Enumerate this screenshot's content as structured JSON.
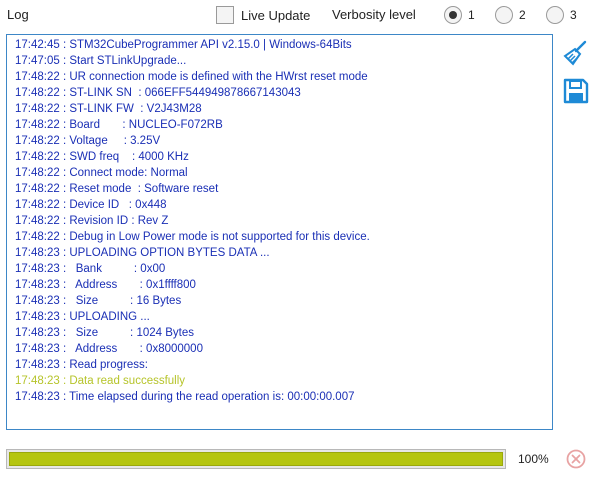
{
  "header": {
    "title": "Log",
    "live_update_label": "Live Update",
    "live_update_checked": false,
    "verbosity_label": "Verbosity level",
    "verbosity_options": [
      "1",
      "2",
      "3"
    ],
    "verbosity_selected": "1"
  },
  "log": {
    "lines": [
      "17:42:45 : STM32CubeProgrammer API v2.15.0 | Windows-64Bits",
      "17:47:05 : Start STLinkUpgrade...",
      "17:48:22 : UR connection mode is defined with the HWrst reset mode",
      "17:48:22 : ST-LINK SN  : 066EFF544949878667143043",
      "17:48:22 : ST-LINK FW  : V2J43M28",
      "17:48:22 : Board       : NUCLEO-F072RB",
      "17:48:22 : Voltage     : 3.25V",
      "17:48:22 : SWD freq    : 4000 KHz",
      "17:48:22 : Connect mode: Normal",
      "17:48:22 : Reset mode  : Software reset",
      "17:48:22 : Device ID   : 0x448",
      "17:48:22 : Revision ID : Rev Z",
      "17:48:22 : Debug in Low Power mode is not supported for this device.",
      "17:48:23 : UPLOADING OPTION BYTES DATA ...",
      "17:48:23 :   Bank          : 0x00",
      "17:48:23 :   Address       : 0x1ffff800",
      "17:48:23 :   Size          : 16 Bytes",
      "17:48:23 : UPLOADING ...",
      "17:48:23 :   Size          : 1024 Bytes",
      "17:48:23 :   Address       : 0x8000000",
      "17:48:23 : Read progress:",
      "17:48:23 : Data read successfully",
      "17:48:23 : Time elapsed during the read operation is: 00:00:00.007"
    ],
    "success_line_index": 21
  },
  "progress": {
    "value_percent": 100,
    "label": "100%"
  },
  "colors": {
    "log_text": "#1a2fb5",
    "success_text": "#b6c42a",
    "progress_fill": "#b5c510",
    "icon_blue": "#1e8ad6",
    "cancel_icon": "#e8a3a3"
  }
}
